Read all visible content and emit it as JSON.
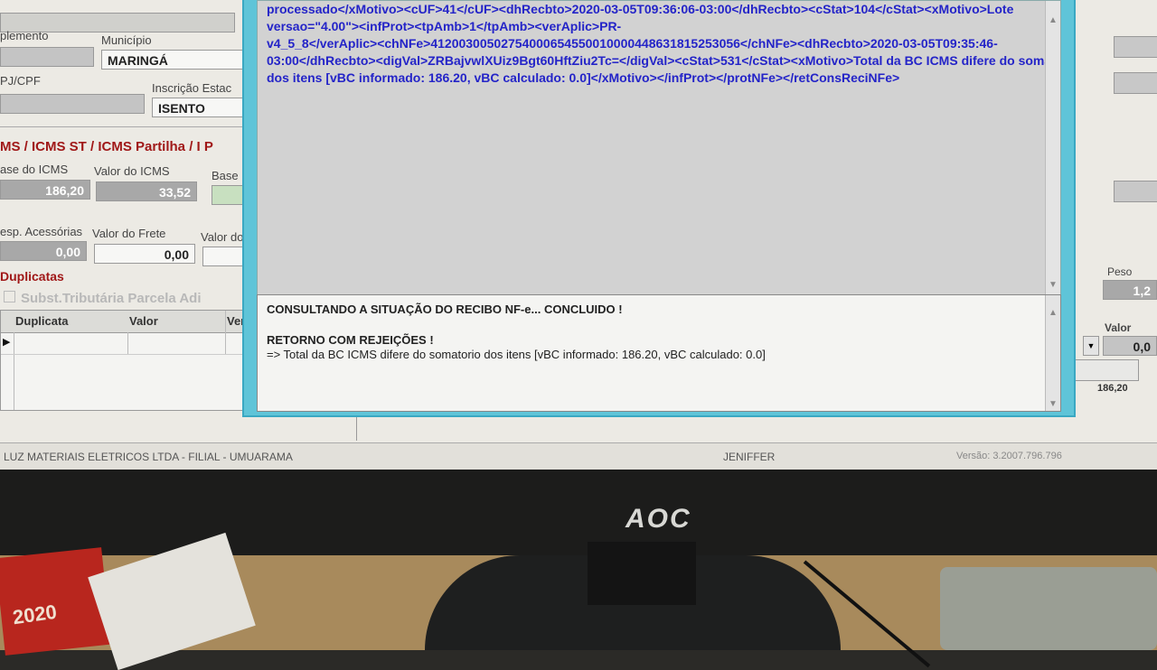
{
  "form": {
    "complemento_label": "plemento",
    "municipio_label": "Município",
    "municipio_value": "MARINGÁ",
    "cnpj_label": "PJ/CPF",
    "inscricao_label": "Inscrição Estac",
    "inscricao_value": "ISENTO",
    "section_title": "MS / ICMS ST / ICMS Partilha / I P",
    "base_icms_label": "ase do ICMS",
    "base_icms_value": "186,20",
    "valor_icms_label": "Valor do ICMS",
    "valor_icms_value": "33,52",
    "base_label": "Base",
    "desp_label": "esp. Acessórias",
    "desp_value": "0,00",
    "frete_label": "Valor do Frete",
    "frete_value": "0,00",
    "valor_do_label": "Valor do",
    "duplicatas_title": "Duplicatas",
    "subst_label": "Subst.Tributária Parcela Adi",
    "grid_headers": [
      "Duplicata",
      "Valor",
      "Ver"
    ]
  },
  "right_panel": {
    "peso_label": "Peso Líqui",
    "peso_value": "1,2",
    "valor_label": "Valor",
    "valor_value": "0,0",
    "total_value": "186,20"
  },
  "dialog": {
    "xml_lines": [
      "processado</xMotivo><cUF>41</cUF><dhRecbto>2020-03-05T09:36:06-03:00</dhRecbto><cStat>104</cStat><xMotivo>Lote",
      "versao=\"4.00\"><infProt><tpAmb>1</tpAmb><verAplic>PR-",
      "v4_5_8</verAplic><chNFe>41200300502754000654550010000448631815253056</chNFe><dhRecbto>2020-03-05T09:35:46-",
      "03:00</dhRecbto><digVal>ZRBajvwlXUiz9Bgt60HftZiu2Tc=</digVal><cStat>531</cStat><xMotivo>Total da BC ICMS difere do somatorio",
      "dos itens [vBC informado: 186.20, vBC calculado: 0.0]</xMotivo></infProt></protNFe></retConsReciNFe>"
    ],
    "status_line1": "CONSULTANDO A SITUAÇÃO DO RECIBO NF-e... CONCLUIDO !",
    "status_line2": "RETORNO COM REJEIÇÕES !",
    "status_line3": "=> Total da BC ICMS difere do somatorio dos itens [vBC informado: 186.20, vBC calculado: 0.0]"
  },
  "statusbar": {
    "company": "LUZ MATERIAIS ELETRICOS LTDA  -  FILIAL - UMUARAMA",
    "user": "JENIFFER",
    "version": "Versão: 3.2007.796.796"
  },
  "monitor": {
    "brand": "AOC",
    "calendar_year": "2020"
  }
}
